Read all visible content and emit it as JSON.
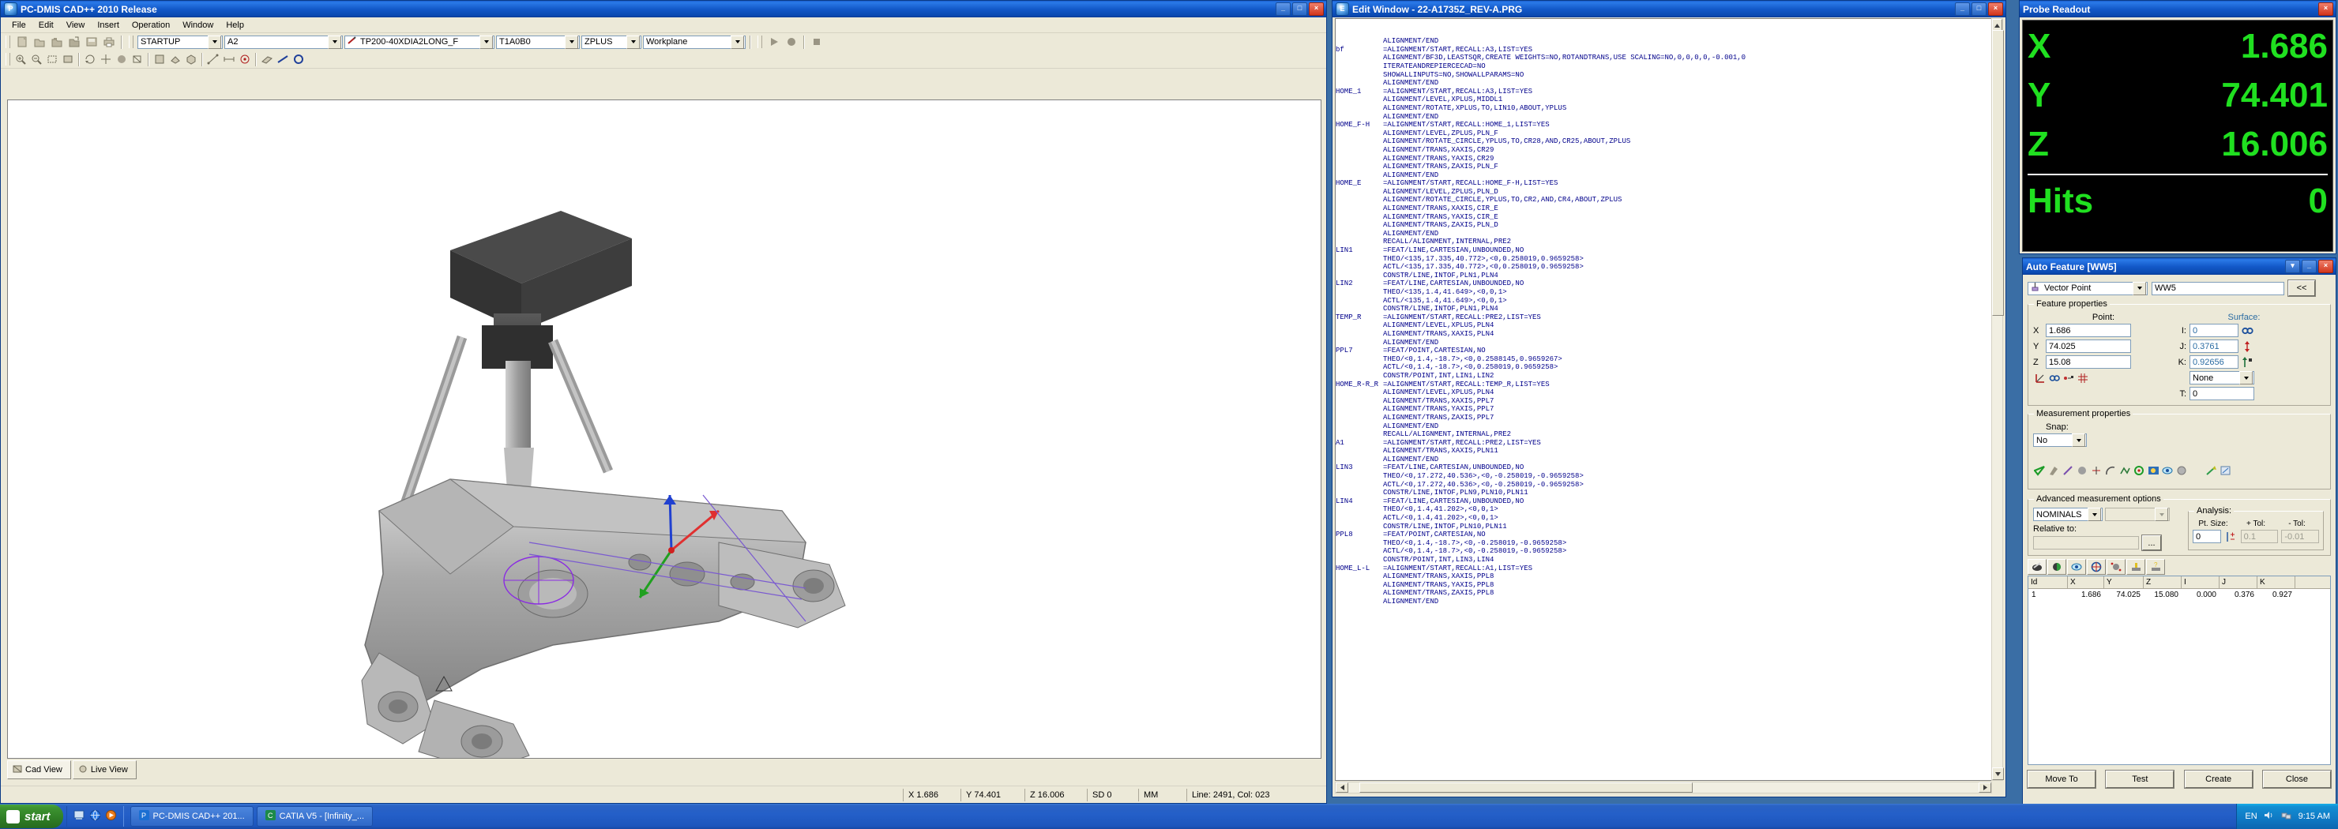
{
  "cad_window": {
    "title": "PC-DMIS CAD++ 2010 Release",
    "menu": [
      "File",
      "Edit",
      "View",
      "Insert",
      "Operation",
      "Window",
      "Help"
    ],
    "toolbar_combos": [
      {
        "name": "alignment",
        "value": "STARTUP"
      },
      {
        "name": "probe-tip-angle",
        "value": "A2"
      },
      {
        "name": "probe-file",
        "value": "TP200-40XDIA2LONG_F"
      },
      {
        "name": "tip-id",
        "value": "T1A0B0"
      },
      {
        "name": "workplane-axis",
        "value": "ZPLUS"
      },
      {
        "name": "coordinate-system",
        "value": "Workplane"
      }
    ],
    "view_tabs": [
      {
        "label": "Cad View",
        "active": true
      },
      {
        "label": "Live View",
        "active": false
      }
    ],
    "status": {
      "x_label": "X",
      "x_value": "1.686",
      "y_label": "Y",
      "y_value": "74.401",
      "z_label": "Z",
      "z_value": "16.006",
      "sd_label": "SD",
      "sd_value": "0",
      "units": "MM",
      "line_col": "Line: 2491, Col: 023"
    }
  },
  "edit_window": {
    "title": "Edit Window - 22-A1735Z_REV-A.PRG",
    "code_lines": [
      {
        "label": "",
        "text": "ALIGNMENT/END"
      },
      {
        "label": "bf",
        "text": "=ALIGNMENT/START,RECALL:A3,LIST=YES"
      },
      {
        "label": "",
        "text": "ALIGNMENT/BF3D,LEASTSQR,CREATE WEIGHTS=NO,ROTANDTRANS,USE SCALING=NO,0,0,0,0,-0.001,0"
      },
      {
        "label": "",
        "text": "ITERATEANDREPIERCECAD=NO"
      },
      {
        "label": "",
        "text": "SHOWALLINPUTS=NO,SHOWALLPARAMS=NO"
      },
      {
        "label": "",
        "text": "ALIGNMENT/END"
      },
      {
        "label": "HOME_1",
        "text": "=ALIGNMENT/START,RECALL:A3,LIST=YES"
      },
      {
        "label": "",
        "text": "ALIGNMENT/LEVEL,XPLUS,MIDDL1"
      },
      {
        "label": "",
        "text": "ALIGNMENT/ROTATE,XPLUS,TO,LIN10,ABOUT,YPLUS"
      },
      {
        "label": "",
        "text": "ALIGNMENT/END"
      },
      {
        "label": "HOME_F-H",
        "text": "=ALIGNMENT/START,RECALL:HOME_1,LIST=YES"
      },
      {
        "label": "",
        "text": "ALIGNMENT/LEVEL,ZPLUS,PLN_F"
      },
      {
        "label": "",
        "text": "ALIGNMENT/ROTATE_CIRCLE,YPLUS,TO,CR28,AND,CR25,ABOUT,ZPLUS"
      },
      {
        "label": "",
        "text": "ALIGNMENT/TRANS,XAXIS,CR29"
      },
      {
        "label": "",
        "text": "ALIGNMENT/TRANS,YAXIS,CR29"
      },
      {
        "label": "",
        "text": "ALIGNMENT/TRANS,ZAXIS,PLN_F"
      },
      {
        "label": "",
        "text": "ALIGNMENT/END"
      },
      {
        "label": "HOME_E",
        "text": "=ALIGNMENT/START,RECALL:HOME_F-H,LIST=YES"
      },
      {
        "label": "",
        "text": "ALIGNMENT/LEVEL,ZPLUS,PLN_D"
      },
      {
        "label": "",
        "text": "ALIGNMENT/ROTATE_CIRCLE,YPLUS,TO,CR2,AND,CR4,ABOUT,ZPLUS"
      },
      {
        "label": "",
        "text": "ALIGNMENT/TRANS,XAXIS,CIR_E"
      },
      {
        "label": "",
        "text": "ALIGNMENT/TRANS,YAXIS,CIR_E"
      },
      {
        "label": "",
        "text": "ALIGNMENT/TRANS,ZAXIS,PLN_D"
      },
      {
        "label": "",
        "text": "ALIGNMENT/END"
      },
      {
        "label": "",
        "text": "RECALL/ALIGNMENT,INTERNAL,PRE2"
      },
      {
        "label": "LIN1",
        "text": "=FEAT/LINE,CARTESIAN,UNBOUNDED,NO"
      },
      {
        "label": "",
        "text": "THEO/<135,17.335,40.772>,<0,0.258019,0.9659258>"
      },
      {
        "label": "",
        "text": "ACTL/<135,17.335,40.772>,<0,0.258019,0.9659258>"
      },
      {
        "label": "",
        "text": "CONSTR/LINE,INTOF,PLN1,PLN4"
      },
      {
        "label": "LIN2",
        "text": "=FEAT/LINE,CARTESIAN,UNBOUNDED,NO"
      },
      {
        "label": "",
        "text": "THEO/<135,1.4,41.649>,<0,0,1>"
      },
      {
        "label": "",
        "text": "ACTL/<135,1.4,41.649>,<0,0,1>"
      },
      {
        "label": "",
        "text": "CONSTR/LINE,INTOF,PLN1,PLN4"
      },
      {
        "label": "TEMP_R",
        "text": "=ALIGNMENT/START,RECALL:PRE2,LIST=YES"
      },
      {
        "label": "",
        "text": "ALIGNMENT/LEVEL,XPLUS,PLN4"
      },
      {
        "label": "",
        "text": "ALIGNMENT/TRANS,XAXIS,PLN4"
      },
      {
        "label": "",
        "text": "ALIGNMENT/END"
      },
      {
        "label": "PPL7",
        "text": "=FEAT/POINT,CARTESIAN,NO"
      },
      {
        "label": "",
        "text": "THEO/<0,1.4,-18.7>,<0,0.2588145,0.9659267>"
      },
      {
        "label": "",
        "text": "ACTL/<0,1.4,-18.7>,<0,0.258019,0.9659258>"
      },
      {
        "label": "",
        "text": "CONSTR/POINT,INT,LIN1,LIN2"
      },
      {
        "label": "HOME_R-R_R",
        "text": "=ALIGNMENT/START,RECALL:TEMP_R,LIST=YES"
      },
      {
        "label": "",
        "text": "ALIGNMENT/LEVEL,XPLUS,PLN4"
      },
      {
        "label": "",
        "text": "ALIGNMENT/TRANS,XAXIS,PPL7"
      },
      {
        "label": "",
        "text": "ALIGNMENT/TRANS,YAXIS,PPL7"
      },
      {
        "label": "",
        "text": "ALIGNMENT/TRANS,ZAXIS,PPL7"
      },
      {
        "label": "",
        "text": "ALIGNMENT/END"
      },
      {
        "label": "",
        "text": "RECALL/ALIGNMENT,INTERNAL,PRE2"
      },
      {
        "label": "A1",
        "text": "=ALIGNMENT/START,RECALL:PRE2,LIST=YES"
      },
      {
        "label": "",
        "text": "ALIGNMENT/TRANS,XAXIS,PLN11"
      },
      {
        "label": "",
        "text": "ALIGNMENT/END"
      },
      {
        "label": "LIN3",
        "text": "=FEAT/LINE,CARTESIAN,UNBOUNDED,NO"
      },
      {
        "label": "",
        "text": "THEO/<0,17.272,40.536>,<0,-0.258019,-0.9659258>"
      },
      {
        "label": "",
        "text": "ACTL/<0,17.272,40.536>,<0,-0.258019,-0.9659258>"
      },
      {
        "label": "",
        "text": "CONSTR/LINE,INTOF,PLN9,PLN10,PLN11"
      },
      {
        "label": "LIN4",
        "text": "=FEAT/LINE,CARTESIAN,UNBOUNDED,NO"
      },
      {
        "label": "",
        "text": "THEO/<0,1.4,41.202>,<0,0,1>"
      },
      {
        "label": "",
        "text": "ACTL/<0,1.4,41.202>,<0,0,1>"
      },
      {
        "label": "",
        "text": "CONSTR/LINE,INTOF,PLN10,PLN11"
      },
      {
        "label": "PPL8",
        "text": "=FEAT/POINT,CARTESIAN,NO"
      },
      {
        "label": "",
        "text": "THEO/<0,1.4,-18.7>,<0,-0.258019,-0.9659258>"
      },
      {
        "label": "",
        "text": "ACTL/<0,1.4,-18.7>,<0,-0.258019,-0.9659258>"
      },
      {
        "label": "",
        "text": "CONSTR/POINT,INT,LIN3,LIN4"
      },
      {
        "label": "HOME_L-L",
        "text": "=ALIGNMENT/START,RECALL:A1,LIST=YES"
      },
      {
        "label": "",
        "text": "ALIGNMENT/TRANS,XAXIS,PPL8"
      },
      {
        "label": "",
        "text": "ALIGNMENT/TRANS,YAXIS,PPL8"
      },
      {
        "label": "",
        "text": "ALIGNMENT/TRANS,ZAXIS,PPL8"
      },
      {
        "label": "",
        "text": "ALIGNMENT/END"
      }
    ]
  },
  "probe_readout": {
    "title": "Probe Readout",
    "rows": [
      {
        "axis": "X",
        "value": "1.686"
      },
      {
        "axis": "Y",
        "value": "74.401"
      },
      {
        "axis": "Z",
        "value": "16.006"
      }
    ],
    "hits_label": "Hits",
    "hits_value": "0",
    "text_color": "#22dd22",
    "bg_color": "#000000"
  },
  "auto_feature": {
    "title": "Auto Feature [WW5]",
    "feature_type": "Vector Point",
    "feature_name": "WW5",
    "collapse_button": "<<",
    "feature_properties": {
      "group_label": "Feature properties",
      "point_label": "Point:",
      "surface_label": "Surface:",
      "x_label": "X",
      "x_value": "1.686",
      "y_label": "Y",
      "y_value": "74.025",
      "z_label": "Z",
      "z_value": "15.08",
      "i_label": "I:",
      "i_value": "0",
      "j_label": "J:",
      "j_value": "0.3761",
      "k_label": "K:",
      "k_value": "0.92656",
      "surface_mode": "None",
      "t_label": "T:",
      "t_value": "0"
    },
    "measurement_properties": {
      "group_label": "Measurement properties",
      "snap_label": "Snap:",
      "snap_value": "No"
    },
    "advanced": {
      "group_label": "Advanced measurement options",
      "mode": "NOMINALS",
      "secondary": "",
      "relative_label": "Relative to:",
      "relative_value": "",
      "browse_button": "...",
      "analysis_label": "Analysis:",
      "pt_size_label": "Pt. Size:",
      "pt_size_value": "0",
      "plus_tol_label": "+ Tol:",
      "plus_tol_value": "0.1",
      "minus_tol_label": "- Tol:",
      "minus_tol_value": "-0.01"
    },
    "hits_grid": {
      "columns": [
        "Id",
        "X",
        "Y",
        "Z",
        "I",
        "J",
        "K"
      ],
      "rows": [
        {
          "Id": "1",
          "X": "1.686",
          "Y": "74.025",
          "Z": "15.080",
          "I": "0.000",
          "J": "0.376",
          "K": "0.927"
        }
      ]
    },
    "buttons": [
      "Move To",
      "Test",
      "Create",
      "Close"
    ]
  },
  "taskbar": {
    "start_label": "start",
    "items": [
      {
        "label": "PC-DMIS CAD++ 201..."
      },
      {
        "label": "CATIA V5 - [Infinity_..."
      }
    ],
    "tray": {
      "lang": "EN",
      "time": "9:15 AM"
    }
  }
}
